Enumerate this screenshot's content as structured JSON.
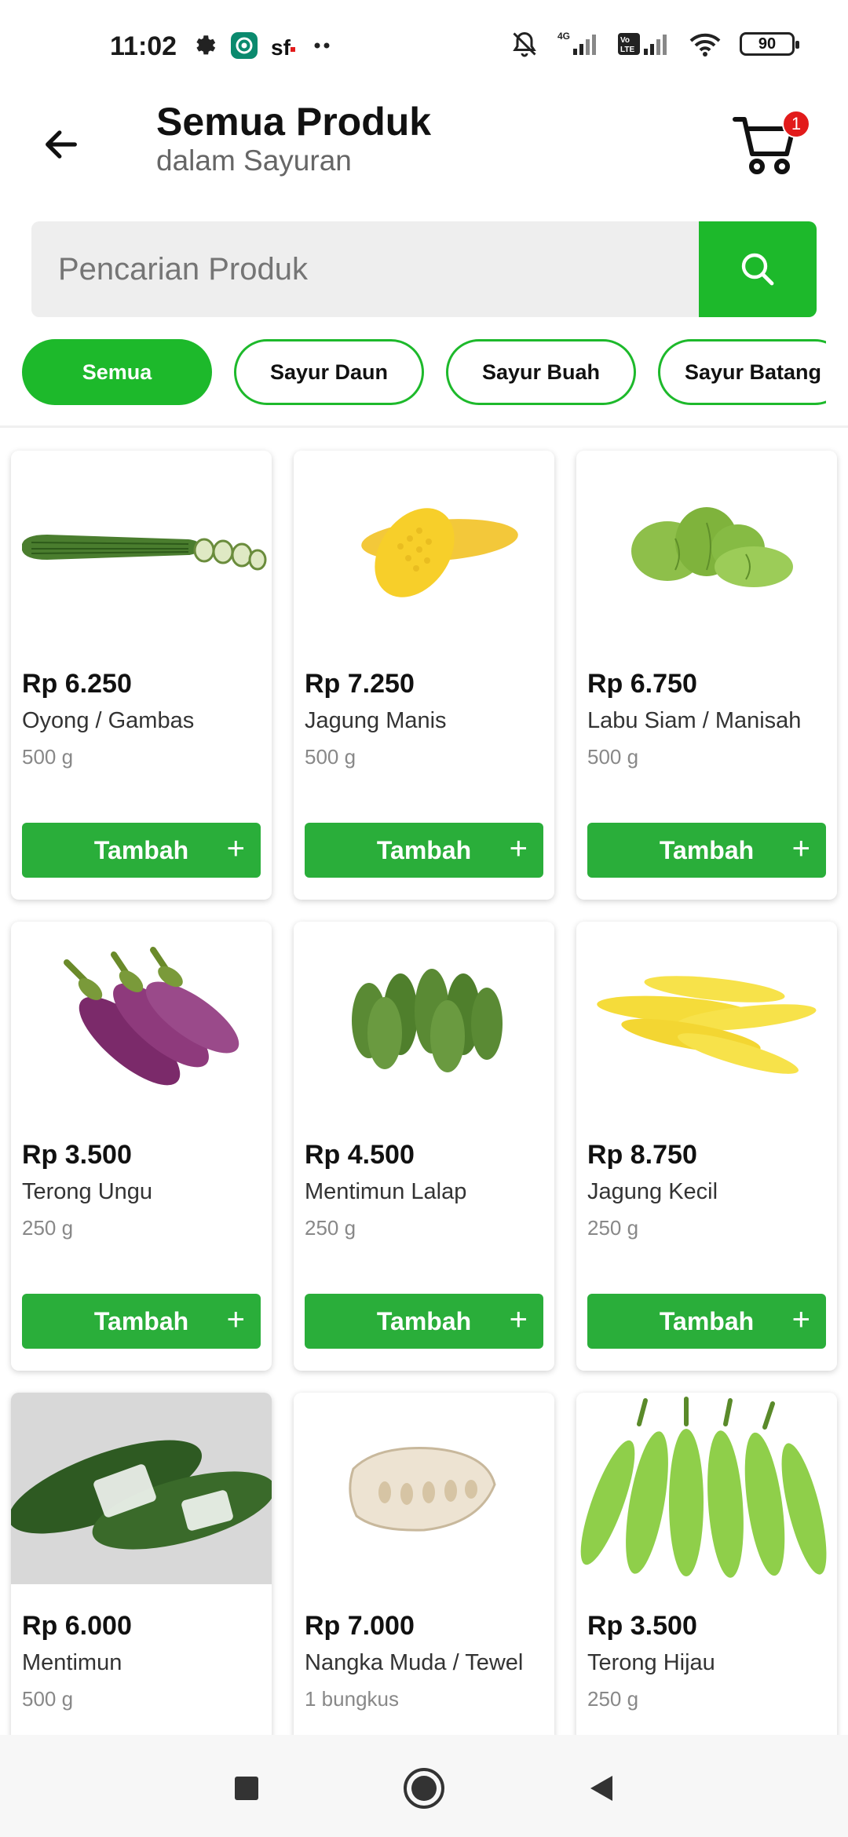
{
  "status_bar": {
    "time": "11:02",
    "battery": "90",
    "network_label": "4G",
    "volte_label": "Vo LTE"
  },
  "header": {
    "title": "Semua Produk",
    "subtitle": "dalam Sayuran",
    "cart_count": "1"
  },
  "search": {
    "placeholder": "Pencarian Produk"
  },
  "chips": [
    {
      "label": "Semua",
      "active": true
    },
    {
      "label": "Sayur Daun",
      "active": false
    },
    {
      "label": "Sayur Buah",
      "active": false
    },
    {
      "label": "Sayur Batang",
      "active": false
    }
  ],
  "add_label": "Tambah",
  "products": [
    {
      "price": "Rp 6.250",
      "name": "Oyong / Gambas",
      "unit": "500 g",
      "icon": "oyong-icon"
    },
    {
      "price": "Rp 7.250",
      "name": "Jagung Manis",
      "unit": "500 g",
      "icon": "corn-icon"
    },
    {
      "price": "Rp 6.750",
      "name": "Labu Siam / Manisah",
      "unit": "500 g",
      "icon": "chayote-icon"
    },
    {
      "price": "Rp 3.500",
      "name": "Terong Ungu",
      "unit": "250 g",
      "icon": "eggplant-icon"
    },
    {
      "price": "Rp 4.500",
      "name": "Mentimun Lalap",
      "unit": "250 g",
      "icon": "cucumber-icon"
    },
    {
      "price": "Rp 8.750",
      "name": "Jagung Kecil",
      "unit": "250 g",
      "icon": "baby-corn-icon"
    },
    {
      "price": "Rp 6.000",
      "name": "Mentimun",
      "unit": "500 g",
      "icon": "cucumber-pack-icon"
    },
    {
      "price": "Rp 7.000",
      "name": "Nangka Muda / Tewel",
      "unit": "1 bungkus",
      "icon": "jackfruit-icon"
    },
    {
      "price": "Rp 3.500",
      "name": "Terong Hijau",
      "unit": "250 g",
      "icon": "green-eggplant-icon"
    }
  ],
  "colors": {
    "accent": "#1db92b",
    "button": "#2aae3a",
    "badge": "#e21b1b"
  }
}
